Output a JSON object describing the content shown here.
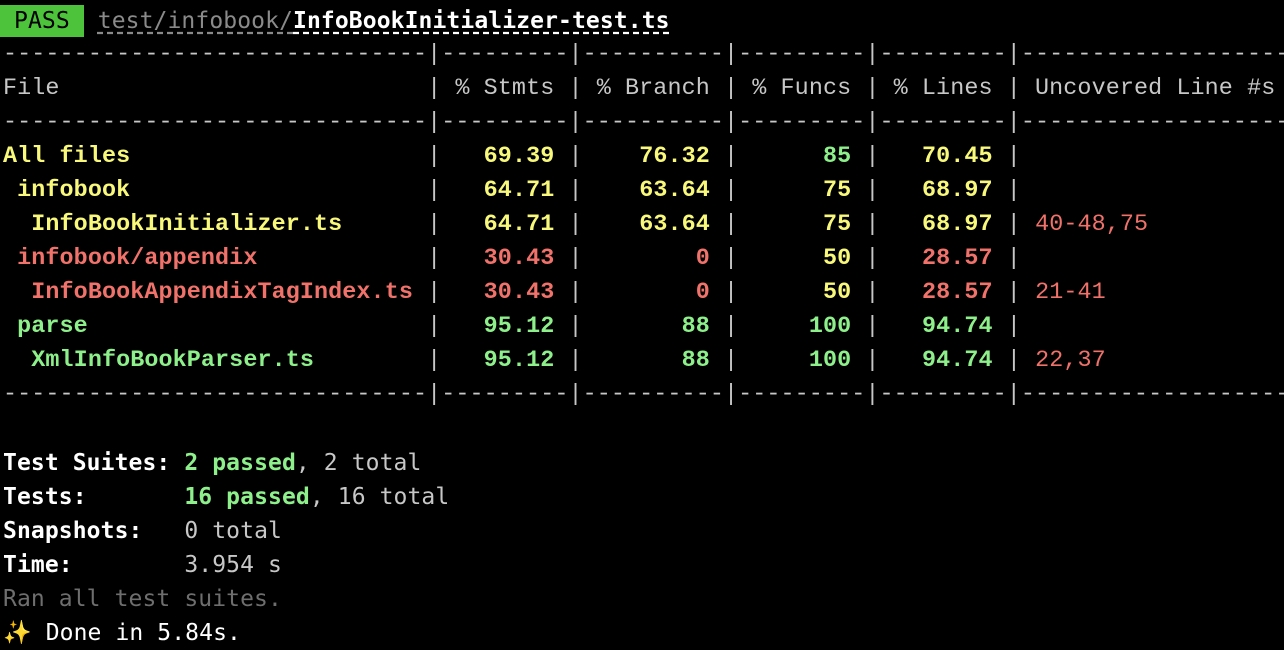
{
  "header": {
    "badge": "PASS",
    "path_dim": "test/infobook/",
    "path_file": "InfoBookInitializer-test.ts"
  },
  "colors": {
    "pass_badge": "#4cc33a",
    "high": "#8ef08b",
    "medium": "#f8f87b",
    "low": "#f0726a"
  },
  "table": {
    "separator": "------------------------------|---------|----------|---------|---------|-------------------",
    "columns": [
      "File",
      "% Stmts",
      "% Branch",
      "% Funcs",
      "% Lines",
      "Uncovered Line #s"
    ],
    "rows": [
      {
        "file": "All files",
        "indent": 0,
        "stmts": "69.39",
        "branch": "76.32",
        "funcs": "85",
        "lines": "70.45",
        "uncovered": "",
        "c_file": "yellow",
        "c_stmts": "yellow",
        "c_branch": "yellow",
        "c_funcs": "green",
        "c_lines": "yellow"
      },
      {
        "file": "infobook",
        "indent": 1,
        "stmts": "64.71",
        "branch": "63.64",
        "funcs": "75",
        "lines": "68.97",
        "uncovered": "",
        "c_file": "yellow",
        "c_stmts": "yellow",
        "c_branch": "yellow",
        "c_funcs": "yellow",
        "c_lines": "yellow"
      },
      {
        "file": "InfoBookInitializer.ts",
        "indent": 2,
        "stmts": "64.71",
        "branch": "63.64",
        "funcs": "75",
        "lines": "68.97",
        "uncovered": "40-48,75",
        "c_file": "yellow",
        "c_stmts": "yellow",
        "c_branch": "yellow",
        "c_funcs": "yellow",
        "c_lines": "yellow"
      },
      {
        "file": "infobook/appendix",
        "indent": 1,
        "stmts": "30.43",
        "branch": "0",
        "funcs": "50",
        "lines": "28.57",
        "uncovered": "",
        "c_file": "red",
        "c_stmts": "red",
        "c_branch": "red",
        "c_funcs": "yellow",
        "c_lines": "red"
      },
      {
        "file": "InfoBookAppendixTagIndex.ts",
        "indent": 2,
        "stmts": "30.43",
        "branch": "0",
        "funcs": "50",
        "lines": "28.57",
        "uncovered": "21-41",
        "c_file": "red",
        "c_stmts": "red",
        "c_branch": "red",
        "c_funcs": "yellow",
        "c_lines": "red"
      },
      {
        "file": "parse",
        "indent": 1,
        "stmts": "95.12",
        "branch": "88",
        "funcs": "100",
        "lines": "94.74",
        "uncovered": "",
        "c_file": "green",
        "c_stmts": "green",
        "c_branch": "green",
        "c_funcs": "green",
        "c_lines": "green"
      },
      {
        "file": "XmlInfoBookParser.ts",
        "indent": 2,
        "stmts": "95.12",
        "branch": "88",
        "funcs": "100",
        "lines": "94.74",
        "uncovered": "22,37",
        "c_file": "green",
        "c_stmts": "green",
        "c_branch": "green",
        "c_funcs": "green",
        "c_lines": "green"
      }
    ]
  },
  "summary": {
    "suites_label": "Test Suites:",
    "suites_passed": "2 passed",
    "suites_total": ", 2 total",
    "tests_label": "Tests:",
    "tests_passed": "16 passed",
    "tests_total": ", 16 total",
    "snapshots_label": "Snapshots:",
    "snapshots_value": "0 total",
    "time_label": "Time:",
    "time_value": "3.954 s",
    "ran_all": "Ran all test suites.",
    "done_icon": "sparkles-icon",
    "done_text": "Done in 5.84s."
  }
}
